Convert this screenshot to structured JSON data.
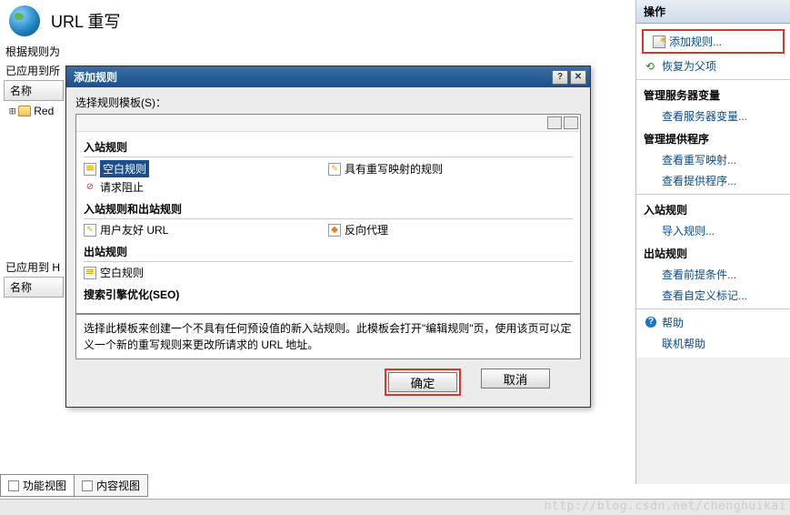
{
  "header": {
    "title": "URL 重写"
  },
  "info_lines": {
    "line1": "根据规则为",
    "line2": "已应用到所"
  },
  "list": {
    "col_name": "名称",
    "tree_item": "Red"
  },
  "applied_h": "已应用到 H",
  "dialog": {
    "title": "添加规则",
    "help_btn": "?",
    "close_btn": "✕",
    "template_label": "选择规则模板(S)：",
    "sections": {
      "inbound": "入站规则",
      "inbound_outbound": "入站规则和出站规则",
      "outbound": "出站规则",
      "seo": "搜索引擎优化(SEO)"
    },
    "items": {
      "blank_rule": "空白规则",
      "request_block": "请求阻止",
      "mapping_rule": "具有重写映射的规则",
      "friendly_url": "用户友好 URL",
      "reverse_proxy": "反向代理",
      "outbound_blank": "空白规则"
    },
    "description": "选择此模板来创建一个不具有任何预设值的新入站规则。此模板会打开\"编辑规则\"页，使用该页可以定义一个新的重写规则来更改所请求的 URL 地址。",
    "ok": "确定",
    "cancel": "取消"
  },
  "sidebar": {
    "header": "操作",
    "add_rule": "添加规则...",
    "restore_parent": "恢复为父项",
    "manage_vars": "管理服务器变量",
    "view_vars": "查看服务器变量...",
    "manage_providers": "管理提供程序",
    "view_mapping": "查看重写映射...",
    "view_providers": "查看提供程序...",
    "inbound_section": "入站规则",
    "import_rules": "导入规则...",
    "outbound_section": "出站规则",
    "view_conditions": "查看前提条件...",
    "view_tags": "查看自定义标记...",
    "help": "帮助",
    "online_help": "联机帮助"
  },
  "tabs": {
    "feature_view": "功能视图",
    "content_view": "内容视图"
  },
  "watermark": "http://blog.csdn.net/chenghuikai"
}
